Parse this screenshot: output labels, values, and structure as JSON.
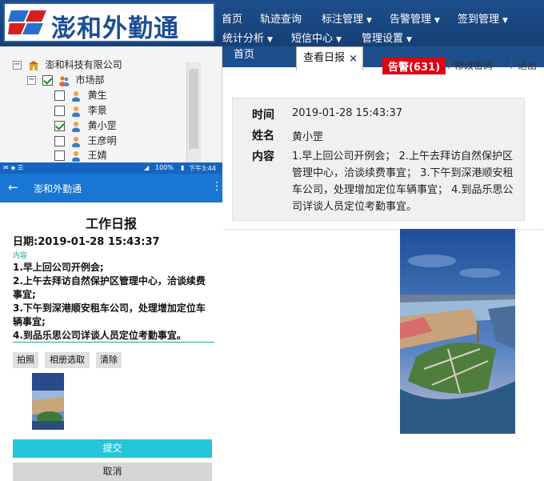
{
  "app": {
    "name": "澎和外勤通"
  },
  "nav": {
    "row1": [
      {
        "label": "首页",
        "dropdown": false
      },
      {
        "label": "轨迹查询",
        "dropdown": false
      },
      {
        "label": "标注管理",
        "dropdown": true
      },
      {
        "label": "告警管理",
        "dropdown": true
      },
      {
        "label": "签到管理",
        "dropdown": true
      }
    ],
    "row2": [
      {
        "label": "统计分析",
        "dropdown": true
      },
      {
        "label": "短信中心",
        "dropdown": true
      },
      {
        "label": "管理设置",
        "dropdown": true
      }
    ]
  },
  "tabs": {
    "home": "首页",
    "view": "查看日报",
    "close_glyph": "×"
  },
  "top_links": {
    "alarm": "告警(631)",
    "change_password": "修改密码",
    "logout": "退出",
    "separator": "|"
  },
  "tree": {
    "company": "澎和科技有限公司",
    "department": "市场部",
    "members": [
      {
        "name": "黄生",
        "checked": false
      },
      {
        "name": "李景",
        "checked": false
      },
      {
        "name": "黄小罡",
        "checked": true
      },
      {
        "name": "王彦明",
        "checked": false
      },
      {
        "name": "王婧",
        "checked": false
      }
    ]
  },
  "mobile": {
    "status": {
      "signal": "100%",
      "time": "下午3:44"
    },
    "appbar_title": "澎和外勤通",
    "report_title": "工作日报",
    "date": "日期:2019-01-28 15:43:37",
    "content_label": "内容",
    "content_lines": [
      "1.早上回公司开例会;",
      "2.上午去拜访自然保护区管理中心，洽谈续费事宜;",
      "3.下午到深港顺安租车公司，处理增加定位车辆事宜;",
      "4.到品乐思公司详谈人员定位考勤事宜。"
    ],
    "buttons": {
      "camera": "拍照",
      "album": "相册选取",
      "clear": "清除",
      "submit": "提交",
      "cancel": "取消"
    }
  },
  "detail": {
    "time_label": "时间",
    "time_value": "2019-01-28 15:43:37",
    "name_label": "姓名",
    "name_value": "黄小罡",
    "content_label": "内容",
    "content_value": "1.早上回公司开例会； 2.上午去拜访自然保护区管理中心，洽谈续费事宜； 3.下午到深港顺安租车公司，处理增加定位车辆事宜； 4.到品乐思公司详谈人员定位考勤事宜。"
  },
  "colors": {
    "header": "#1d4e8c",
    "alarm": "#e00010",
    "teal": "#26c6da",
    "appbar": "#1976d2"
  }
}
